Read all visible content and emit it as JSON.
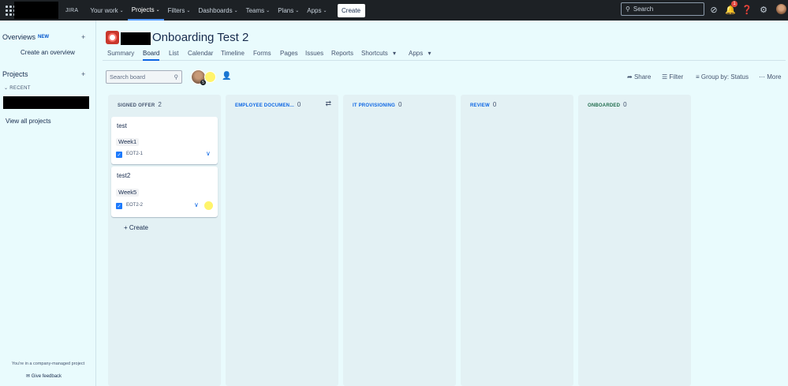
{
  "topnav": {
    "product": "JIRA",
    "items": [
      {
        "label": "Your work",
        "active": false
      },
      {
        "label": "Projects",
        "active": true
      },
      {
        "label": "Filters",
        "active": false
      },
      {
        "label": "Dashboards",
        "active": false
      },
      {
        "label": "Teams",
        "active": false
      },
      {
        "label": "Plans",
        "active": false
      },
      {
        "label": "Apps",
        "active": false
      }
    ],
    "create_label": "Create",
    "search_placeholder": "Search",
    "notification_count": "1"
  },
  "sidebar": {
    "overviews_heading": "Overviews",
    "new_badge": "NEW",
    "create_overview": "Create an overview",
    "projects_heading": "Projects",
    "recent_label": "RECENT",
    "view_all": "View all projects",
    "footnote": "You're in a company-managed project",
    "feedback": "Give feedback"
  },
  "project": {
    "title": "Onboarding Test 2",
    "tabs": [
      "Summary",
      "Board",
      "List",
      "Calendar",
      "Timeline",
      "Forms",
      "Pages",
      "Issues",
      "Reports",
      "Shortcuts",
      "Apps"
    ],
    "active_tab": "Board"
  },
  "toolbar": {
    "search_placeholder": "Search board",
    "avatar_badge": "5",
    "share": "Share",
    "filter": "Filter",
    "group_by": "Group by: Status",
    "more": "More"
  },
  "columns": [
    {
      "name": "SIGNED OFFER",
      "count": "2",
      "color": "#44546f"
    },
    {
      "name": "EMPLOYEE DOCUMEN...",
      "count": "0",
      "color": "#0c66e4"
    },
    {
      "name": "IT PROVISIONING",
      "count": "0",
      "color": "#0c66e4"
    },
    {
      "name": "REVIEW",
      "count": "0",
      "color": "#0c66e4"
    },
    {
      "name": "ONBOARDED",
      "count": "0",
      "color": "#216e4e"
    }
  ],
  "cards": [
    {
      "title": "test",
      "label": "Week1",
      "key": "EOT2-1",
      "priority": "low",
      "assignee": false
    },
    {
      "title": "test2",
      "label": "Week5",
      "key": "EOT2-2",
      "priority": "low",
      "assignee": true
    }
  ],
  "column_create_label": "Create",
  "colors": {
    "topnav_bg": "#1d2125",
    "page_bg": "#e9fbfd",
    "accent": "#0c66e4"
  }
}
